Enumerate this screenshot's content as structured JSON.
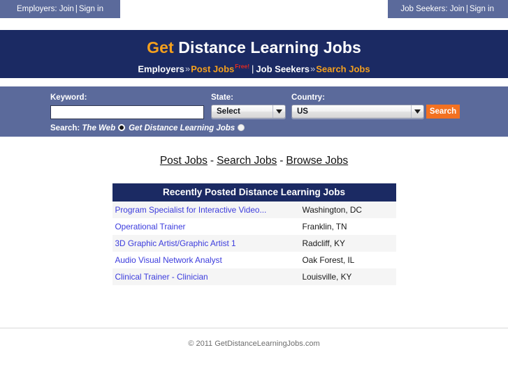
{
  "topbar": {
    "employers": {
      "prefix": "Employers:",
      "join": "Join",
      "sep": "|",
      "signin": "Sign in"
    },
    "jobseekers": {
      "prefix": "Job Seekers:",
      "join": "Join",
      "sep": "|",
      "signin": "Sign in"
    }
  },
  "masthead": {
    "title_accent": "Get",
    "title_rest": " Distance Learning Jobs",
    "sub_employers": "Employers",
    "chev1": "»",
    "sub_post_jobs": "Post Jobs",
    "free_badge": "Free!",
    "pipe": "|",
    "sub_jobseekers": "Job Seekers",
    "chev2": "»",
    "sub_search_jobs": "Search Jobs"
  },
  "search": {
    "keyword_label": "Keyword:",
    "keyword_value": "",
    "keyword_placeholder": "",
    "state_label": "State:",
    "state_selected": "Select",
    "country_label": "Country:",
    "country_selected": "US",
    "button_label": "Search",
    "scope_prefix": "Search:",
    "scope_web": "The Web",
    "scope_site": "Get Distance Learning Jobs"
  },
  "nav": {
    "post_jobs": "Post Jobs",
    "dash1": "-",
    "search_jobs": "Search Jobs",
    "dash2": "-",
    "browse_jobs": "Browse Jobs"
  },
  "jobs": {
    "heading": "Recently Posted Distance Learning Jobs",
    "rows": [
      {
        "title": "Program Specialist for Interactive Video...",
        "location": "Washington, DC"
      },
      {
        "title": "Operational Trainer",
        "location": "Franklin, TN"
      },
      {
        "title": "3D Graphic Artist/Graphic Artist 1",
        "location": "Radcliff, KY"
      },
      {
        "title": "Audio Visual Network Analyst",
        "location": "Oak Forest, IL"
      },
      {
        "title": "Clinical Trainer - Clinician",
        "location": "Louisville, KY"
      }
    ]
  },
  "footer": {
    "copyright": "© 2011 GetDistanceLearningJobs.com"
  },
  "colors": {
    "navy": "#1b2a63",
    "slate": "#5b6a9b",
    "orange": "#f37121",
    "gold": "#f5a01d",
    "link_blue": "#3b3bdd",
    "free_red": "#e8281e"
  }
}
